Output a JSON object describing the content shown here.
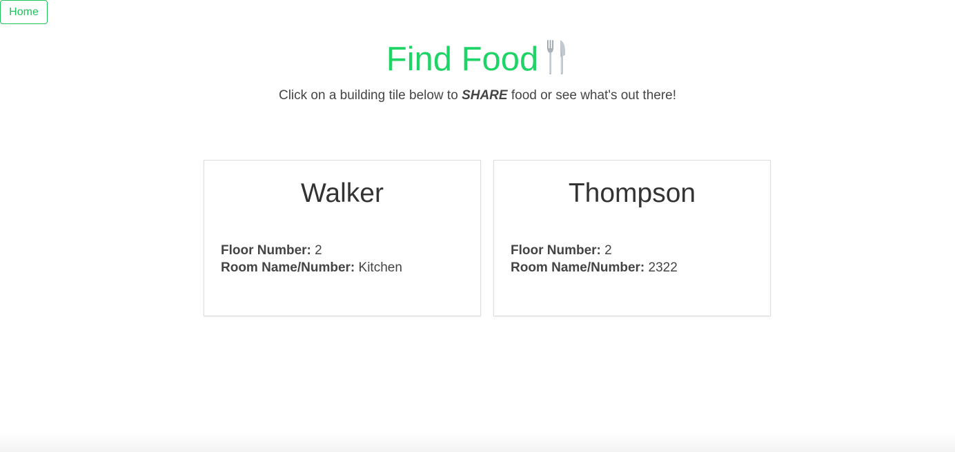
{
  "nav": {
    "home_label": "Home"
  },
  "header": {
    "title": "Find Food",
    "title_icon": "fork-and-knife-icon",
    "subtitle_before": "Click on a building tile below to ",
    "subtitle_emphasis": "SHARE",
    "subtitle_after": " food or see what's out there!"
  },
  "buildings": [
    {
      "name": "Walker",
      "floor_label": "Floor Number:",
      "floor_value": "2",
      "room_label": "Room Name/Number:",
      "room_value": "Kitchen"
    },
    {
      "name": "Thompson",
      "floor_label": "Floor Number:",
      "floor_value": "2",
      "room_label": "Room Name/Number:",
      "room_value": "2322"
    }
  ],
  "colors": {
    "accent": "#1fd467",
    "button_border": "#1fc25a",
    "text": "#444444",
    "card_border": "#dddddd"
  }
}
